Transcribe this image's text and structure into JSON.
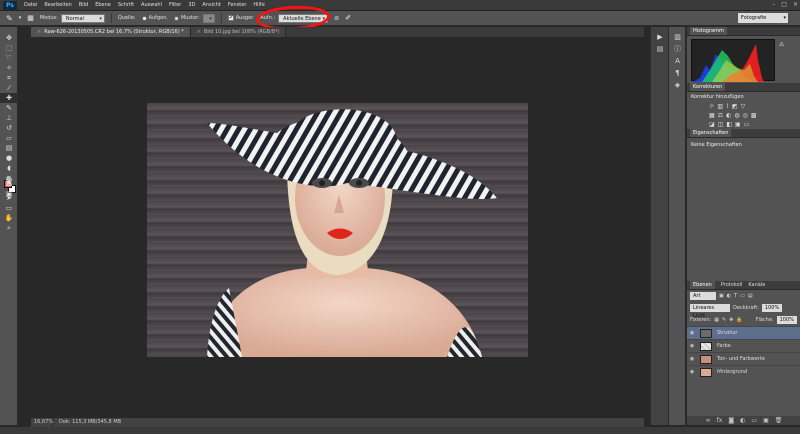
{
  "menubar": {
    "logo": "Ps",
    "items": [
      "Datei",
      "Bearbeiten",
      "Bild",
      "Ebene",
      "Schrift",
      "Auswahl",
      "Filter",
      "3D",
      "Ansicht",
      "Fenster",
      "Hilfe"
    ]
  },
  "options": {
    "mode_label": "Modus:",
    "mode_value": "Normal",
    "source_label": "Quelle:",
    "sampled_label": "Aufgen.",
    "pattern_label": "Muster:",
    "aligned_label": "Ausger.",
    "sample_label": "Aufn.:",
    "sample_value": "Aktuelle Ebene",
    "workspace": "Fotografie"
  },
  "tabs": [
    "Raw-626-20130505.CR2 bei 16,7% (Struktur, RGB/16) *",
    "Bild 10.jpg bei 100% (RGB/8*)"
  ],
  "status": {
    "zoom": "16,67%",
    "doc": "Dok: 115,3 MB/345,8 MB"
  },
  "panels": {
    "histogram_title": "Histogramm",
    "adjust_tab": "Korrekturen",
    "adjust_title": "Korrektur hinzufügen",
    "props_tab": "Eigenschaften",
    "props_text": "Keine Eigenschaften",
    "layers_tabs": [
      "Ebenen",
      "Protokoll",
      "Kanäle"
    ],
    "kind_label": "Art",
    "blend_mode": "Lineares Licht",
    "opacity_label": "Deckkraft:",
    "opacity_value": "100%",
    "lock_label": "Fixieren:",
    "fill_label": "Fläche:",
    "fill_value": "100%",
    "layers": [
      {
        "name": "Struktur"
      },
      {
        "name": "Farbe"
      },
      {
        "name": "Ton- und Farbwerte"
      },
      {
        "name": "Hintergrund"
      }
    ]
  },
  "colors": {
    "foreground": "#dd5a3a",
    "background": "#ffffff",
    "annotation": "#ff1010"
  }
}
